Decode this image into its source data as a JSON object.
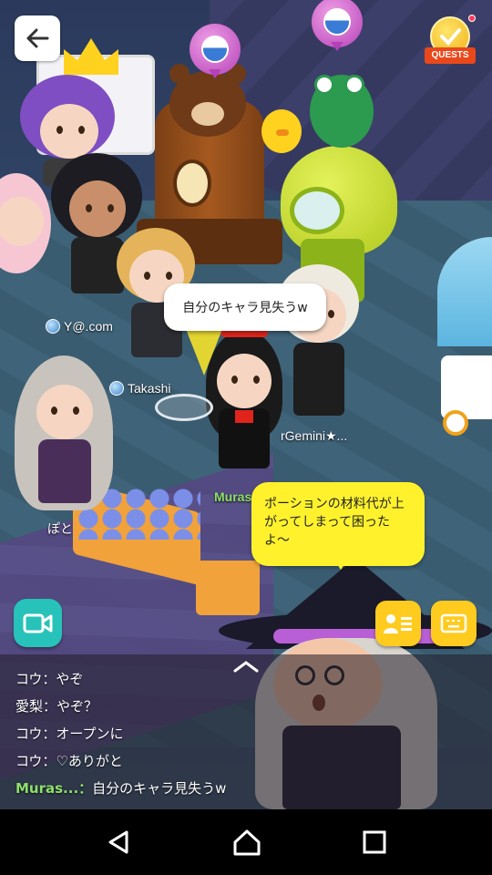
{
  "top": {
    "quest_label": "QUESTS"
  },
  "speech": {
    "player_bubble": "自分のキャラ見失うw",
    "npc_bubble": "ポーションの材料代が上がってしまって困ったよ〜"
  },
  "nameplates": {
    "y_com": "Y@.com",
    "takashi": "Takashi",
    "gemini": "rGemini★...",
    "muras": "Muras",
    "poto": "ぽと"
  },
  "chat": {
    "lines": [
      {
        "who": "コウ",
        "sep": "：",
        "text": "やぞ"
      },
      {
        "who": "愛梨",
        "sep": "：",
        "text": "やぞ？"
      },
      {
        "who": "コウ",
        "sep": "：",
        "text": "オープンに"
      },
      {
        "who": "コウ",
        "sep": "：",
        "text": "♡ありがと"
      },
      {
        "who": "Muras...",
        "sep": "：",
        "text": "自分のキャラ見失うw"
      }
    ]
  },
  "colors": {
    "accent_teal": "#27c2b9",
    "accent_yellow": "#ffcb1f",
    "self_name_green": "#8ee06a"
  },
  "icons": {
    "back": "arrow-left-icon",
    "video": "video-camera-icon",
    "friends": "friend-list-icon",
    "keyboard": "keyboard-icon",
    "collapse": "chevron-up-icon"
  }
}
